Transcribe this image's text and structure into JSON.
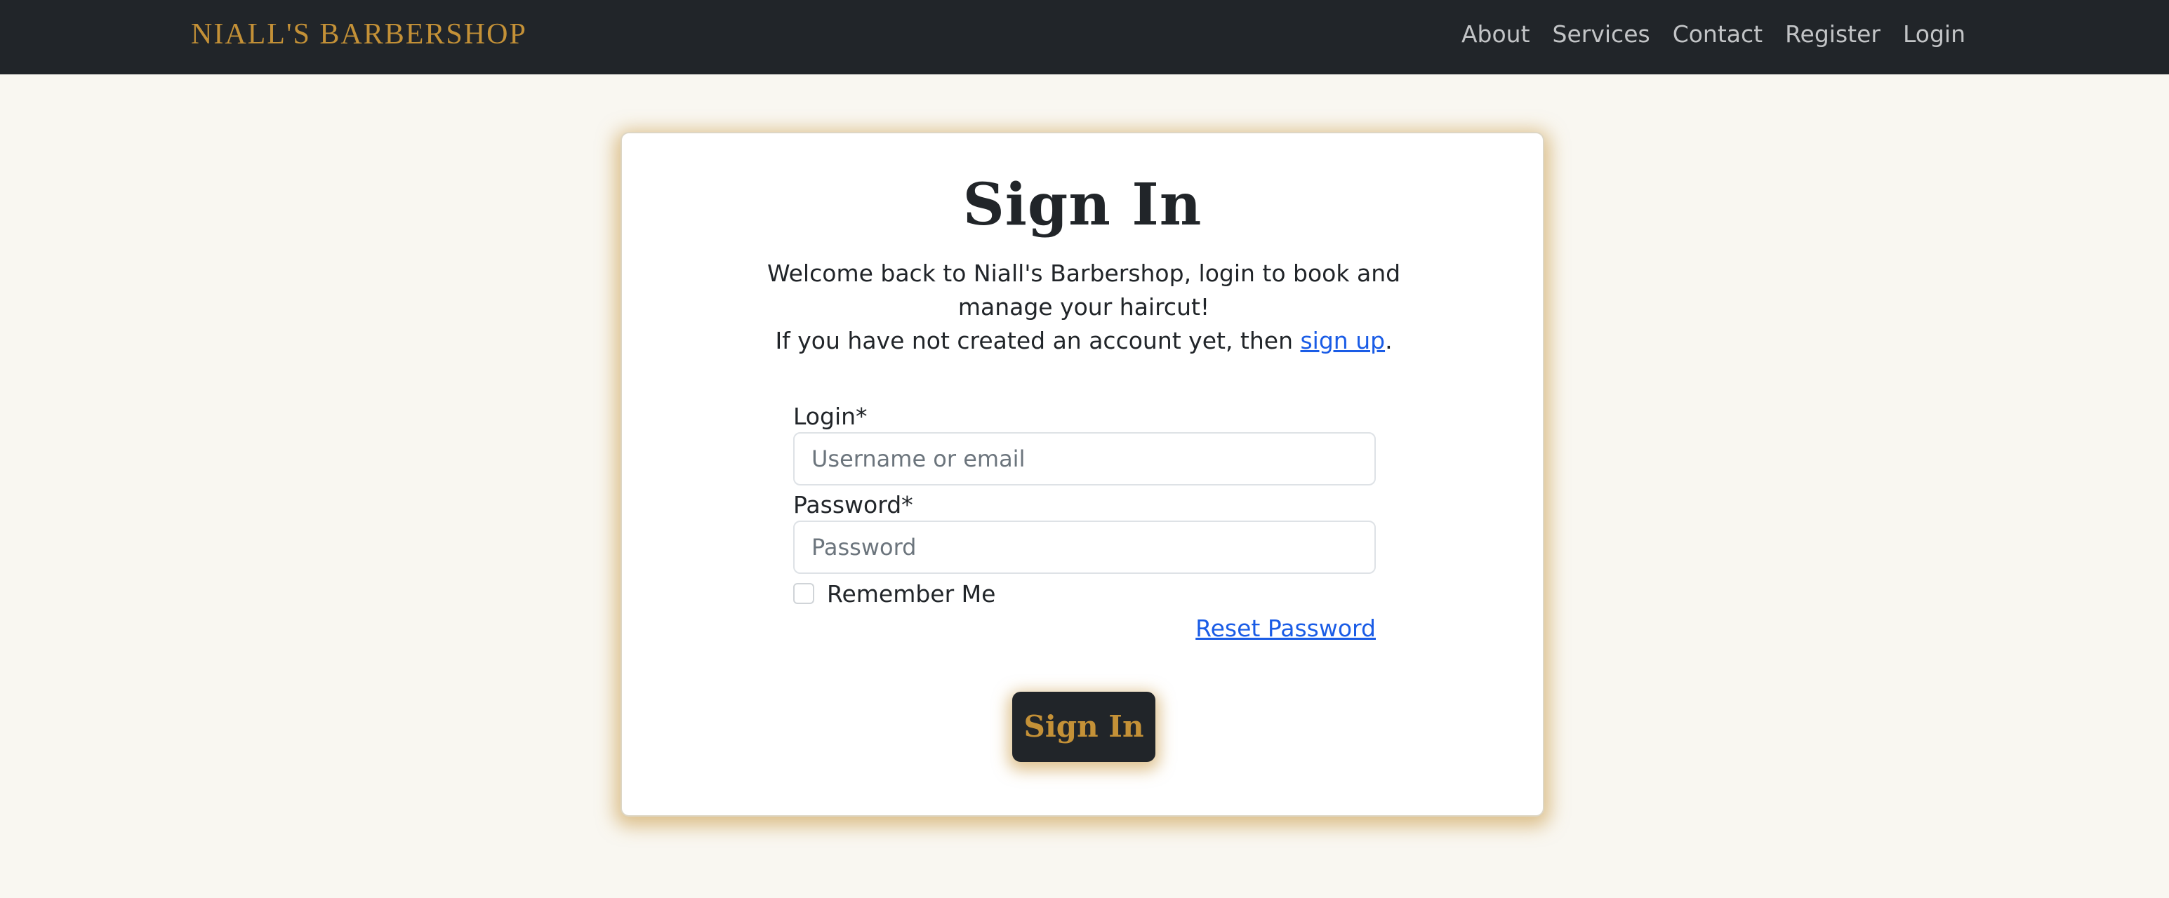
{
  "navbar": {
    "brand": "NIALL'S BARBERSHOP",
    "links": [
      "About",
      "Services",
      "Contact",
      "Register",
      "Login"
    ]
  },
  "card": {
    "title": "Sign In",
    "intro_line1": "Welcome back to Niall's Barbershop, login to book and manage your haircut!",
    "intro_line2_prefix": "If you have not created an account yet, then ",
    "signup_link": "sign up",
    "intro_line2_suffix": "."
  },
  "form": {
    "login_label": "Login*",
    "login_placeholder": "Username or email",
    "password_label": "Password*",
    "password_placeholder": "Password",
    "remember_label": "Remember Me",
    "reset_link": "Reset Password",
    "submit_label": "Sign In"
  },
  "colors": {
    "navbar_bg": "#212529",
    "brand_gold": "#c49137",
    "page_bg": "#f9f7f1",
    "link_blue": "#1a5ce6"
  }
}
